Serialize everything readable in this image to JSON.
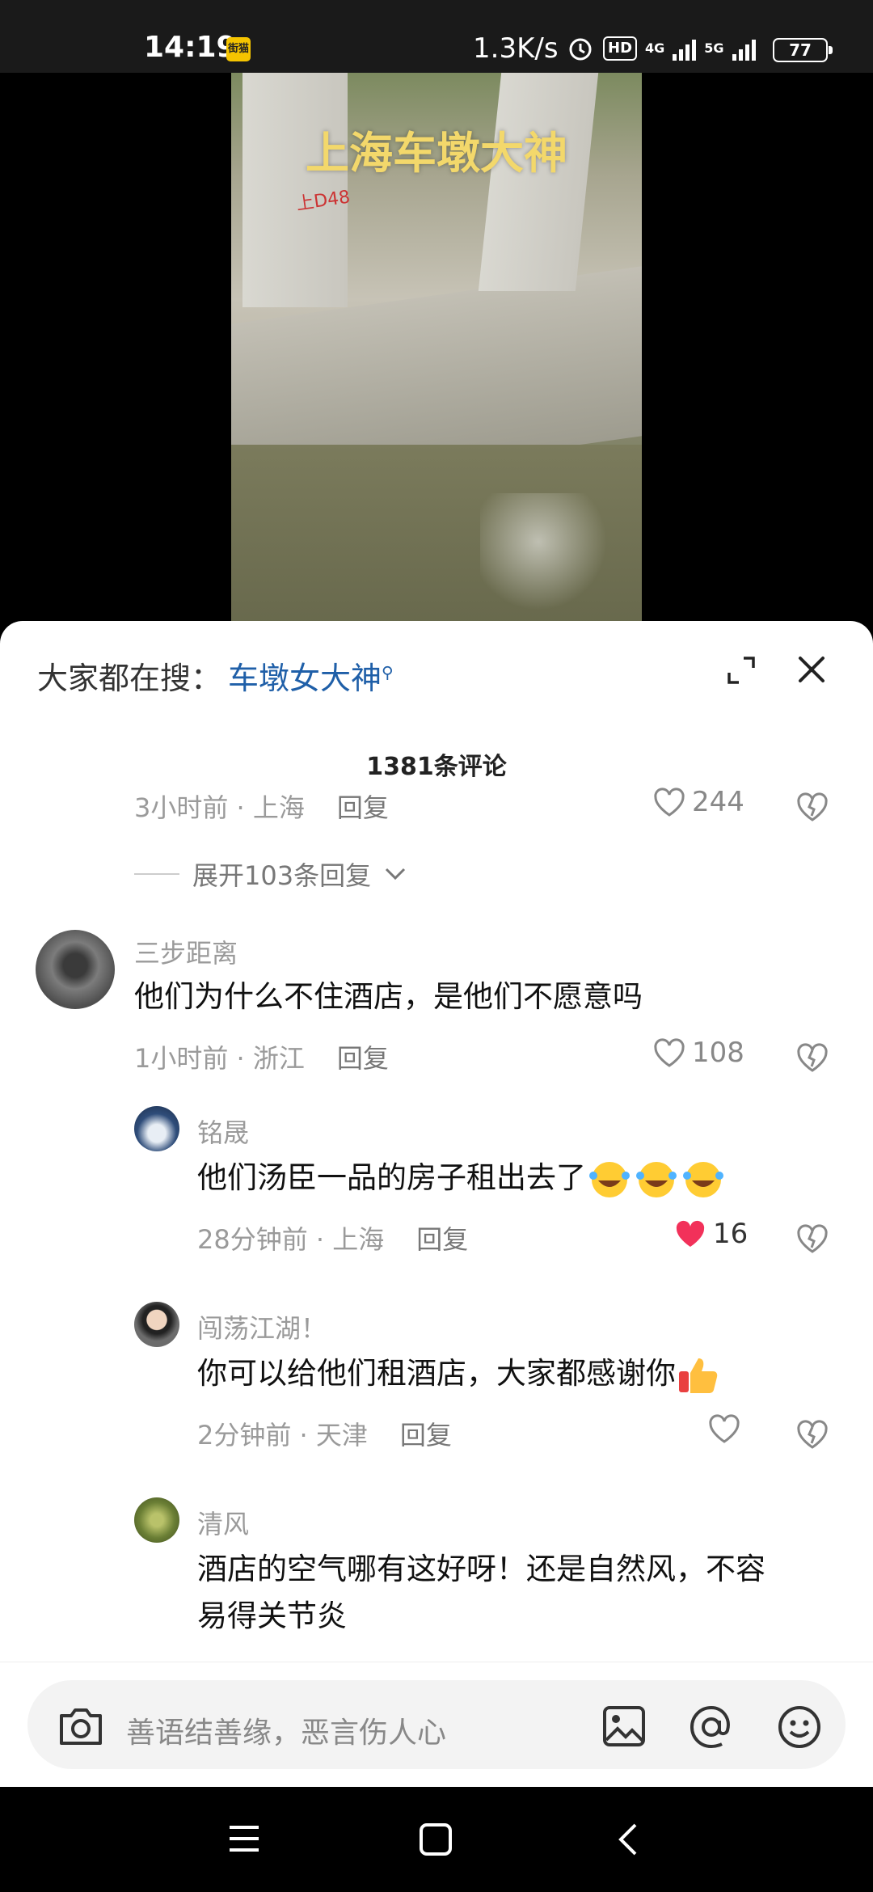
{
  "status_bar": {
    "time": "14:19",
    "app_badge": "街猫",
    "net_speed": "1.3K/s",
    "hd_label": "HD",
    "net_4g": "4G",
    "net_5g": "5G",
    "battery": "77"
  },
  "video": {
    "overlay_title": "上海车墩大神",
    "pillar_mark": "上D48"
  },
  "sheet": {
    "search_prefix": "大家都在搜：",
    "search_keyword": "车墩女大神",
    "comment_count": "1381条评论"
  },
  "comments": {
    "top": {
      "time": "3小时前",
      "location": "上海",
      "reply": "回复",
      "likes": "244",
      "expand": "展开103条回复"
    },
    "c1": {
      "username": "三步距离",
      "text": "他们为什么不住酒店，是他们不愿意吗",
      "time": "1小时前",
      "location": "浙江",
      "reply": "回复",
      "likes": "108"
    },
    "r1": {
      "username": "铭晟",
      "text": "他们汤臣一品的房子租出去了",
      "time": "28分钟前",
      "location": "上海",
      "reply": "回复",
      "likes": "16",
      "liked": true
    },
    "r2": {
      "username": "闯荡江湖！",
      "text": "你可以给他们租酒店，大家都感谢你",
      "time": "2分钟前",
      "location": "天津",
      "reply": "回复",
      "likes": ""
    },
    "r3": {
      "username": "清风",
      "text_line1": "酒店的空气哪有这好呀！还是自然风，不容",
      "text_line2": "易得关节炎"
    }
  },
  "input": {
    "placeholder": "善语结善缘，恶言伤人心"
  },
  "colors": {
    "accent_link": "#1f5fa8",
    "liked_heart": "#f2315a",
    "overlay_title": "#f3d86b"
  }
}
